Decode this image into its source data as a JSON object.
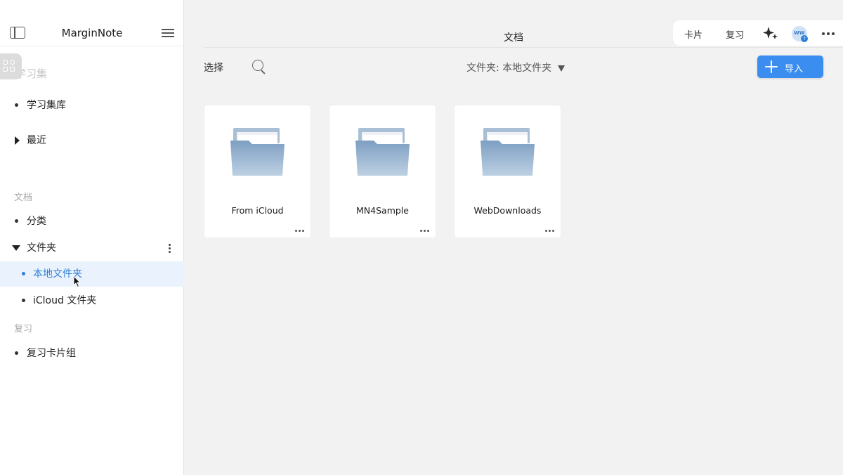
{
  "app": {
    "name": "MarginNote"
  },
  "sidebar": {
    "faded_heading": "学习集",
    "study": {
      "library": "学习集库",
      "recent": "最近"
    },
    "documents": {
      "section": "文档",
      "category": "分类",
      "folders": "文件夹",
      "local_folder": "本地文件夹",
      "icloud_folder": "iCloud 文件夹"
    },
    "review": {
      "section": "复习",
      "card_group": "复习卡片组"
    },
    "selected_item": "本地文件夹"
  },
  "main": {
    "title": "文档",
    "toolbar": {
      "select": "选择",
      "filter_label": "文件夹:",
      "filter_value": "本地文件夹",
      "import": "导入"
    },
    "topbar": {
      "cards": "卡片",
      "review": "复习"
    },
    "folders": [
      {
        "name": "From iCloud"
      },
      {
        "name": "MN4Sample"
      },
      {
        "name": "WebDownloads"
      }
    ]
  },
  "colors": {
    "accent": "#3b8ef0",
    "selected_text": "#2f7fd8",
    "selected_bg": "#eaf3fd"
  },
  "icons": [
    "sidebar-toggle-icon",
    "menu-icon",
    "apps-icon",
    "search-icon",
    "sparkle-icon",
    "ai-assistant-icon",
    "more-icon",
    "plus-icon",
    "folder-icon",
    "ellipsis-icon",
    "cursor-icon"
  ]
}
